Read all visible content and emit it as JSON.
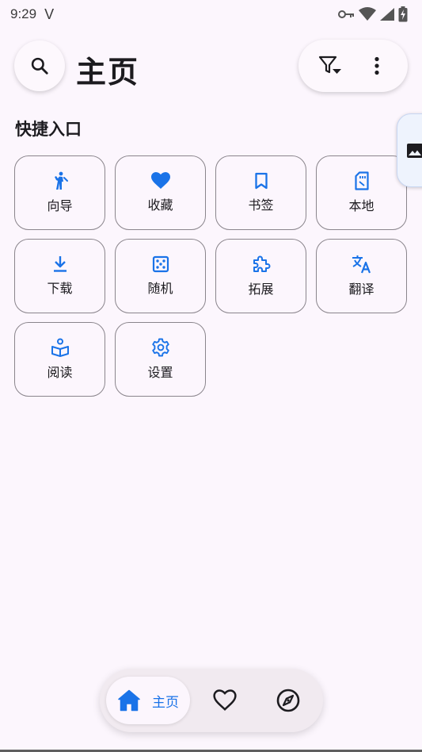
{
  "status_bar": {
    "time": "9:29",
    "carrier_glyph": "V",
    "icons": [
      "key-icon",
      "wifi-icon",
      "signal-icon",
      "battery-charging-icon"
    ]
  },
  "header": {
    "title": "主页",
    "search_icon": "search-icon",
    "actions": [
      "filter-icon",
      "more-vert-icon"
    ]
  },
  "quick_access": {
    "title": "快捷入口",
    "items": [
      {
        "label": "向导",
        "icon": "guide-icon"
      },
      {
        "label": "收藏",
        "icon": "heart-icon"
      },
      {
        "label": "书签",
        "icon": "bookmark-icon"
      },
      {
        "label": "本地",
        "icon": "sd-card-icon"
      },
      {
        "label": "下载",
        "icon": "download-icon"
      },
      {
        "label": "随机",
        "icon": "dice-icon"
      },
      {
        "label": "拓展",
        "icon": "extension-icon"
      },
      {
        "label": "翻译",
        "icon": "translate-icon"
      },
      {
        "label": "阅读",
        "icon": "reading-icon"
      },
      {
        "label": "设置",
        "icon": "settings-icon"
      }
    ]
  },
  "side_tab": {
    "icon": "image-icon"
  },
  "bottom_nav": {
    "items": [
      {
        "label": "主页",
        "icon": "home-icon",
        "selected": true
      },
      {
        "label": "",
        "icon": "heart-outline-icon",
        "selected": false
      },
      {
        "label": "",
        "icon": "explore-icon",
        "selected": false
      }
    ]
  },
  "colors": {
    "accent": "#1a73e8",
    "background": "#fcf6fd",
    "text": "#1c1b1f",
    "outline": "#8a858c"
  }
}
